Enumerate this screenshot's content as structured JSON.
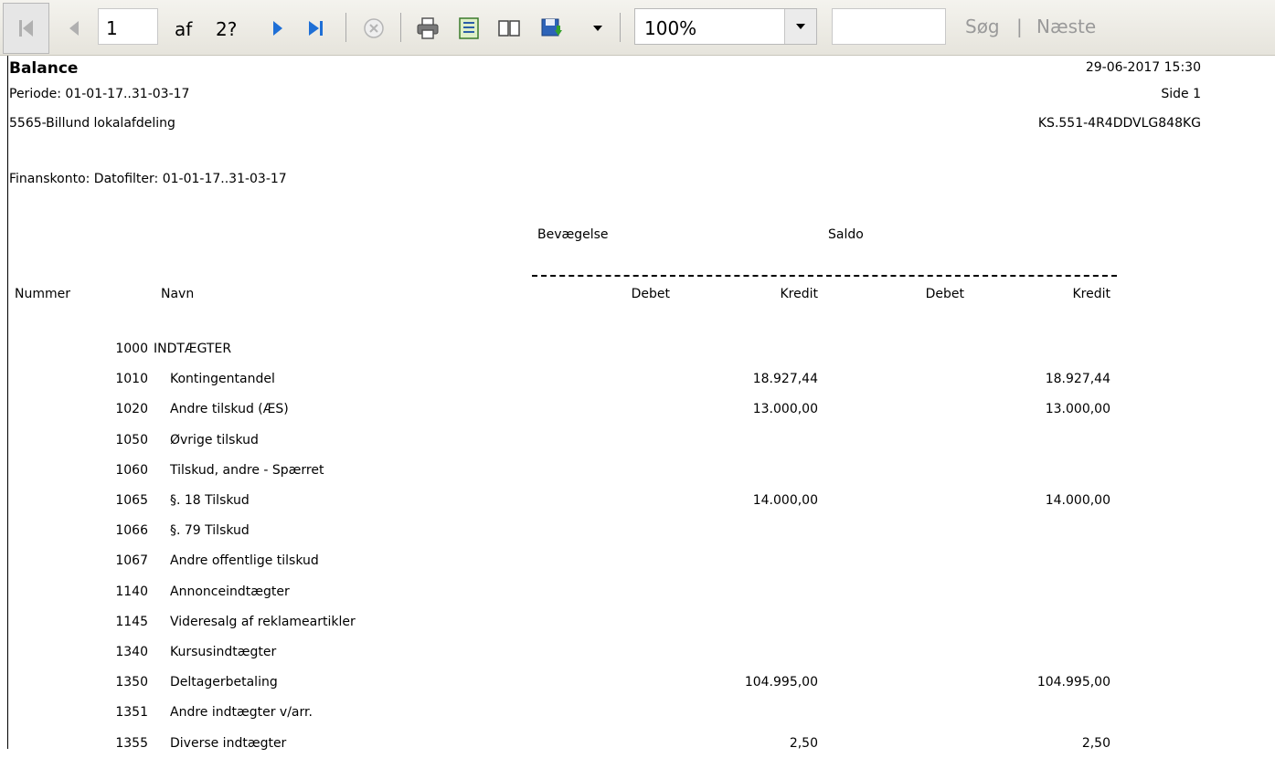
{
  "toolbar": {
    "page_current": "1",
    "page_of_label": "af",
    "page_total": "2?",
    "zoom": "100%",
    "search_value": "",
    "search_label": "Søg",
    "separator": "|",
    "next_label": "Næste",
    "icons": [
      "first-page-icon",
      "previous-page-icon",
      "next-page-icon",
      "last-page-icon",
      "stop-icon",
      "print-icon",
      "page-setup-icon",
      "print-layout-icon",
      "save-icon",
      "dropdown-arrow-icon"
    ]
  },
  "report": {
    "title": "Balance",
    "datetime": "29-06-2017 15:30",
    "period": "Periode: 01-01-17..31-03-17",
    "page": "Side 1",
    "company": "5565-Billund lokalafdeling",
    "code": "KS.551-4R4DDVLG848KG",
    "filter": "Finanskonto: Datofilter: 01-01-17..31-03-17",
    "group_headers": {
      "movement": "Bevægelse",
      "balance": "Saldo"
    },
    "columns": {
      "number": "Nummer",
      "name": "Navn",
      "debit1": "Debet",
      "credit1": "Kredit",
      "debit2": "Debet",
      "credit2": "Kredit"
    },
    "rows": [
      {
        "number": "1000",
        "name": "INDTÆGTER",
        "debit1": "",
        "credit1": "",
        "debit2": "",
        "credit2": "",
        "heading": true
      },
      {
        "number": "1010",
        "name": "Kontingentandel",
        "debit1": "",
        "credit1": "18.927,44",
        "debit2": "",
        "credit2": "18.927,44"
      },
      {
        "number": "1020",
        "name": "Andre tilskud (ÆS)",
        "debit1": "",
        "credit1": "13.000,00",
        "debit2": "",
        "credit2": "13.000,00"
      },
      {
        "number": "1050",
        "name": "Øvrige tilskud",
        "debit1": "",
        "credit1": "",
        "debit2": "",
        "credit2": ""
      },
      {
        "number": "1060",
        "name": "Tilskud, andre - Spærret",
        "debit1": "",
        "credit1": "",
        "debit2": "",
        "credit2": ""
      },
      {
        "number": "1065",
        "name": "§. 18 Tilskud",
        "debit1": "",
        "credit1": "14.000,00",
        "debit2": "",
        "credit2": "14.000,00"
      },
      {
        "number": "1066",
        "name": "§. 79 Tilskud",
        "debit1": "",
        "credit1": "",
        "debit2": "",
        "credit2": ""
      },
      {
        "number": "1067",
        "name": "Andre offentlige tilskud",
        "debit1": "",
        "credit1": "",
        "debit2": "",
        "credit2": ""
      },
      {
        "number": "1140",
        "name": "Annonceindtægter",
        "debit1": "",
        "credit1": "",
        "debit2": "",
        "credit2": ""
      },
      {
        "number": "1145",
        "name": "Videresalg af reklameartikler",
        "debit1": "",
        "credit1": "",
        "debit2": "",
        "credit2": ""
      },
      {
        "number": "1340",
        "name": "Kursusindtægter",
        "debit1": "",
        "credit1": "",
        "debit2": "",
        "credit2": ""
      },
      {
        "number": "1350",
        "name": "Deltagerbetaling",
        "debit1": "",
        "credit1": "104.995,00",
        "debit2": "",
        "credit2": "104.995,00"
      },
      {
        "number": "1351",
        "name": "Andre indtægter v/arr.",
        "debit1": "",
        "credit1": "",
        "debit2": "",
        "credit2": ""
      },
      {
        "number": "1355",
        "name": "Diverse indtægter",
        "debit1": "",
        "credit1": "2,50",
        "debit2": "",
        "credit2": "2,50"
      }
    ]
  }
}
